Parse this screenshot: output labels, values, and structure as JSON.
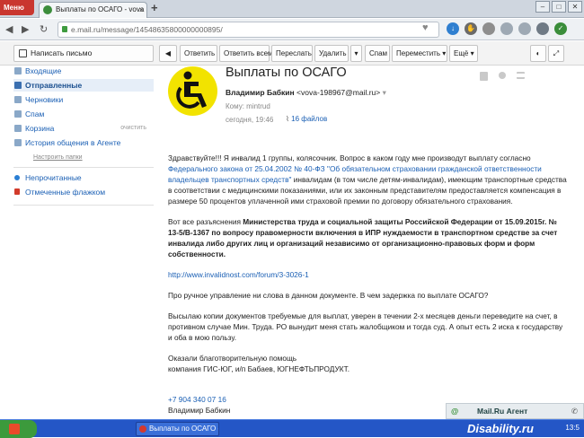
{
  "browser": {
    "menu_label": "Меню",
    "tab_title": "Выплаты по ОСАГО - vova",
    "url": "e.mail.ru/message/14548635800000000895/"
  },
  "toolbar": {
    "compose": "Написать письмо",
    "reply": "Ответить",
    "reply_all": "Ответить всем",
    "forward": "Переслать",
    "delete": "Удалить",
    "spam": "Спам",
    "move": "Переместить",
    "more": "Ещё"
  },
  "sidebar": {
    "items": [
      {
        "label": "Входящие"
      },
      {
        "label": "Отправленные"
      },
      {
        "label": "Черновики"
      },
      {
        "label": "Спам"
      },
      {
        "label": "Корзина",
        "action": "очистить"
      },
      {
        "label": "История общения в Агенте"
      }
    ],
    "setup": "Настроить папки",
    "unread": "Непрочитанные",
    "flagged": "Отмеченные флажком"
  },
  "message": {
    "subject": "Выплаты по ОСАГО",
    "sender_name": "Владимир Бабкин",
    "sender_email": "<vova-198967@mail.ru>",
    "to_label": "Кому:",
    "to": "mintrud",
    "date": "сегодня, 19:46",
    "files": "16 файлов",
    "p1_a": "Здравствуйте!!! Я инвалид 1 группы, колясочник. Вопрос в каком году мне производут выплату согласно ",
    "p1_link": "Федерального закона от 25.04.2002 № 40-ФЗ \"Об обязательном страховании гражданской ответственности владельцев транспортных средств\"",
    "p1_b": " инвалидам (в том числе детям-инвалидам), имеющим транспортные средства в соответствии с медицинскими показаниями, или их законным представителям предоставляется компенсация в размере 50 процентов уплаченной ими страховой премии по договору обязательного страхования.",
    "p2_a": "Вот все разъяснения ",
    "p2_bold": "Министерства труда и социальной защиты Российской Федерации от 15.09.2015г. № 13-5/В-1367 по вопросу правомерности включения в ИПР нуждаемости в транспортном средстве за счет инвалида либо других лиц и организаций независимо от организационно-правовых форм и форм собственности.",
    "p3_link": "http://www.invalidnost.com/forum/3-3026-1",
    "p4": "Про ручное управление ни слова в данном документе. В чем задержка по выплате ОСАГО?",
    "p5": "Высылаю копии документов требуемые для выплат, уверен в течении 2-х месяцев деньги переведите на счет, в противном случае Мин. Труда. РО вынудит меня стать жалобщиком и тогда суд. А опыт есть 2 иска к государству и оба в мою пользу.",
    "p6_l1": "Оказали благотворительную помощь",
    "p6_l2": "компания ГИС-ЮГ, и/п Бабаев, ЮГНЕФТЬПРОДУКТ.",
    "phone": "+7 904 340 07 16",
    "signature": "Владимир Бабкин"
  },
  "agent": {
    "label": "Mail.Ru Агент"
  },
  "taskbar": {
    "item": "Выплаты по ОСАГО -...",
    "watermark": "Disability.ru",
    "clock": "13:5"
  }
}
